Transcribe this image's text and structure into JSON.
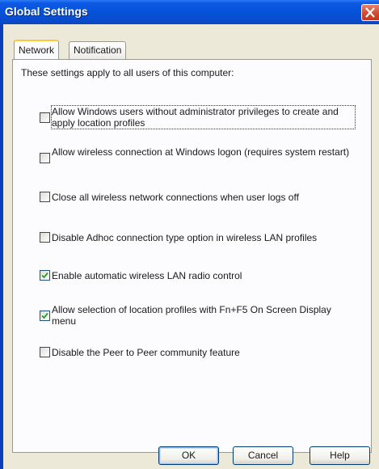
{
  "window": {
    "title": "Global Settings"
  },
  "tabs": [
    {
      "label": "Network",
      "active": true
    },
    {
      "label": "Notification",
      "active": false
    }
  ],
  "intro": "These settings apply to all users of this computer:",
  "options": [
    {
      "label": "Allow Windows users without administrator privileges to create and apply location profiles",
      "checked": false
    },
    {
      "label": "Allow wireless connection at Windows logon (requires system restart)",
      "checked": false
    },
    {
      "label": "Close all wireless network connections when user logs off",
      "checked": false
    },
    {
      "label": "Disable Adhoc connection type option in wireless LAN profiles",
      "checked": false
    },
    {
      "label": "Enable automatic wireless LAN radio control",
      "checked": true
    },
    {
      "label": "Allow selection of location profiles with Fn+F5 On Screen Display menu",
      "checked": true
    },
    {
      "label": "Disable the Peer to Peer community feature",
      "checked": false
    }
  ],
  "buttons": {
    "ok": "OK",
    "cancel": "Cancel",
    "help": "Help"
  },
  "icons": {
    "close": "close-icon",
    "check": "check-icon"
  },
  "colors": {
    "titlebar": "#0553d9",
    "dialog_bg": "#ece9d8",
    "panel_bg": "#fcfcfe",
    "check": "#21a121"
  }
}
